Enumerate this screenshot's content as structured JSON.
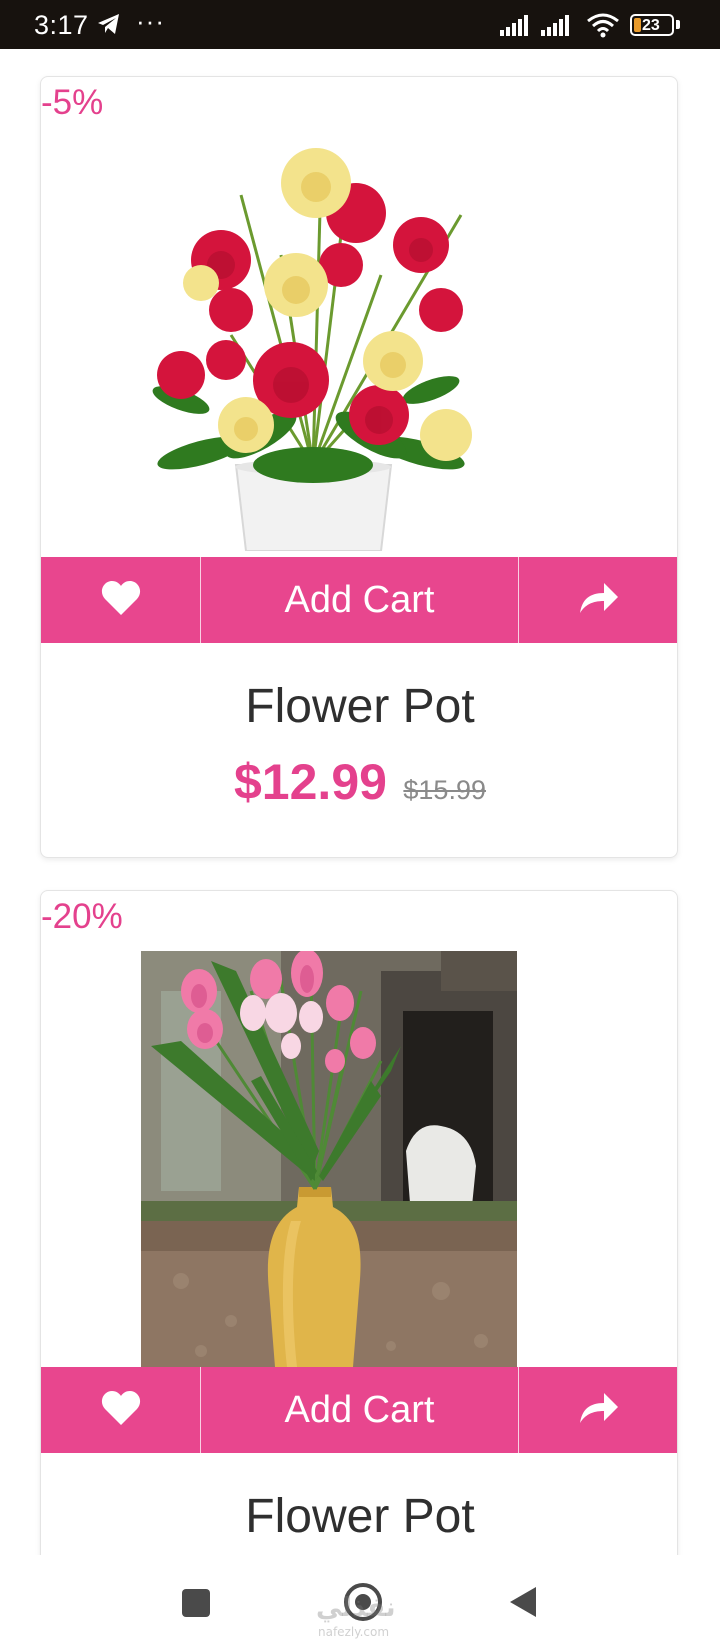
{
  "status_bar": {
    "time": "3:17",
    "more": "···",
    "battery_level": "23",
    "icons": [
      "telegram-icon",
      "signal-icon",
      "signal-icon",
      "wifi-icon",
      "battery-icon"
    ]
  },
  "products": [
    {
      "discount": "-5%",
      "image": "flower-pot-carnations-image",
      "add_cart_label": "Add Cart",
      "title": "Flower Pot",
      "price": "$12.99",
      "old_price": "$15.99"
    },
    {
      "discount": "-20%",
      "image": "tulip-vase-image",
      "add_cart_label": "Add Cart",
      "title": "Flower Pot"
    }
  ],
  "colors": {
    "accent": "#e8468e",
    "discount_text": "#e4418d",
    "title_text": "#2f2f2f",
    "status_bar_bg": "#17120e"
  },
  "nav_bar": {
    "buttons": [
      "recents-button",
      "home-button",
      "back-button"
    ],
    "watermark": "نفذلي",
    "watermark_sub": "nafezly.com"
  }
}
